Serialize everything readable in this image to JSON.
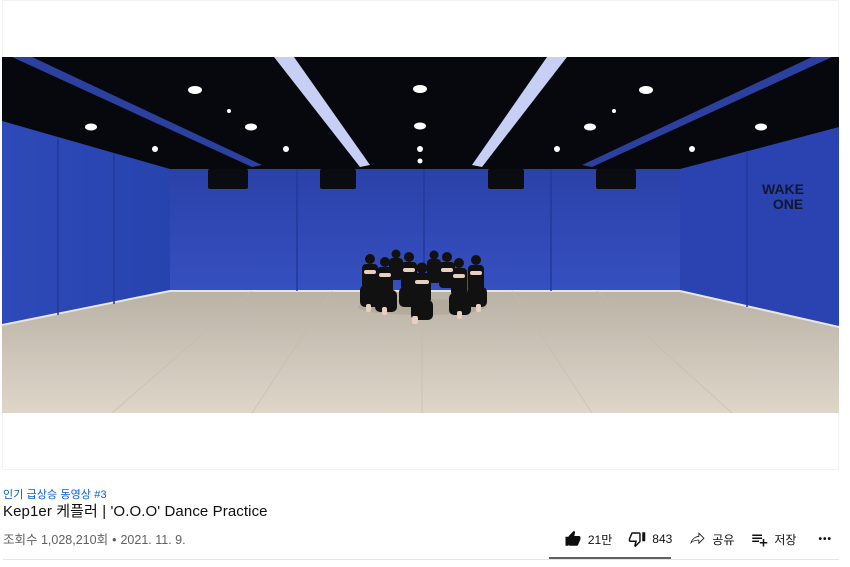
{
  "video": {
    "scene_wall_text_line1": "WAKE",
    "scene_wall_text_line2": "ONE"
  },
  "info": {
    "hashtag": "인기 급상승 동영상 #3",
    "title": "Kep1er 케플러 | 'O.O.O' Dance Practice",
    "views": "조회수 1,028,210회",
    "bullet": "•",
    "date": "2021. 11. 9."
  },
  "actions": {
    "like_count": "21만",
    "dislike_count": "843",
    "share_label": "공유",
    "save_label": "저장",
    "more_label": "•••"
  },
  "colors": {
    "link": "#065fd4",
    "wall_blue": "#2f46b2",
    "floor": "#cfc7b8",
    "ceiling": "#07080d"
  },
  "icons": [
    "thumb-up-icon",
    "thumb-down-icon",
    "share-icon",
    "save-playlist-icon",
    "more-icon"
  ]
}
